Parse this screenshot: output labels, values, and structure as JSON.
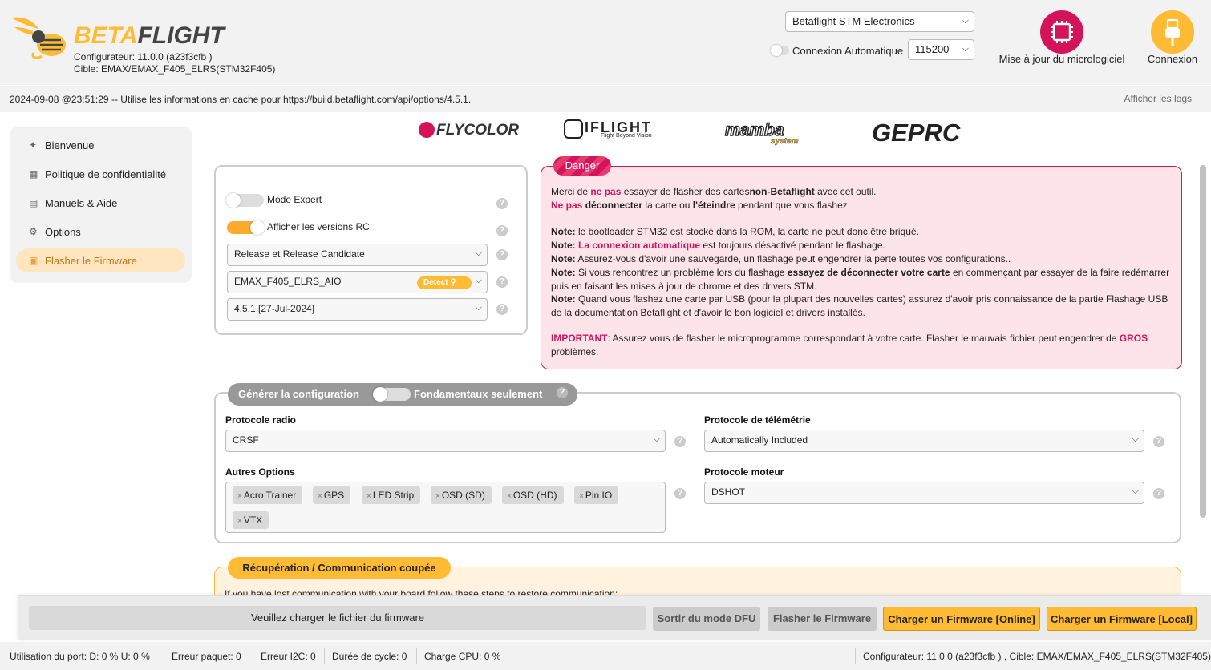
{
  "header": {
    "brand_part1": "BETA",
    "brand_part2": "FLIGHT",
    "configurator_version": "Configurateur: 11.0.0 (a23f3cfb )",
    "target": "Cible: EMAX/EMAX_F405_ELRS(STM32F405)",
    "port_select": "Betaflight STM Electronics",
    "auto_connect_label": "Connexion Automatique",
    "baud_select": "115200",
    "firmware_update_label": "Mise à jour du micrologiciel",
    "connect_label": "Connexion"
  },
  "logbar": {
    "message": "2024-09-08 @23:51:29 -- Utilise les informations en cache pour https://build.betaflight.com/api/options/4.5.1.",
    "show_logs": "Afficher les logs"
  },
  "sidebar": {
    "items": [
      {
        "label": "Bienvenue",
        "icon": "welcome-icon"
      },
      {
        "label": "Politique de confidentialité",
        "icon": "privacy-icon"
      },
      {
        "label": "Manuels & Aide",
        "icon": "book-icon"
      },
      {
        "label": "Options",
        "icon": "gear-icon"
      },
      {
        "label": "Flasher le Firmware",
        "icon": "chip-icon",
        "active": true
      }
    ]
  },
  "sponsors": [
    "FLYCOLOR",
    "IFLIGHT",
    "Flight Beyond Vision",
    "mamba",
    "system",
    "GEPRC"
  ],
  "firmware": {
    "expert_mode": "Mode Expert",
    "show_rc": "Afficher les versions RC",
    "release_select": "Release et Release Candidate",
    "board_select": "EMAX_F405_ELRS_AIO",
    "detect_label": "Detect",
    "version_select": "4.5.1 [27-Jul-2024]",
    "help": "?"
  },
  "danger": {
    "title": "Danger",
    "l1_a": "Merci de ",
    "l1_b": "ne pas",
    "l1_c": " essayer de flasher des cartes",
    "l1_d": "non-Betaflight",
    "l1_e": " avec cet outil.",
    "l2_a": "Ne pas",
    "l2_b": "déconnecter",
    "l2_c": " la carte ou ",
    "l2_d": "l'éteindre",
    "l2_e": " pendant que vous flashez.",
    "note": "Note:",
    "n1": " le bootloader STM32 est stocké dans la ROM, la carte ne peut donc être briqué.",
    "n2_a": "La connexion automatique",
    "n2_b": " est toujours désactivé pendant le flashage.",
    "n3": " Assurez-vous d'avoir une sauvegarde, un flashage peut engendrer la perte toutes vos configurations..",
    "n4_a": " Si vous rencontrez un problème lors du flashage ",
    "n4_b": "essayez de déconnecter votre carte",
    "n4_c": " en commençant par essayer de la faire redémarrer puis en faisant les mises à jour de chrome et des drivers STM.",
    "n5": " Quand vous flashez une carte par USB (pour la plupart des nouvelles cartes) assurez d'avoir pris connaissance de la partie Flashage USB de la documentation Betaflight et d'avoir le bon logiciel et drivers installés.",
    "imp_a": "IMPORTANT",
    "imp_b": ": Assurez vous de flasher le microprogramme correspondant à votre carte. Flasher le mauvais fichier peut engendrer de ",
    "imp_c": "GROS",
    "imp_d": " problèmes."
  },
  "build": {
    "title": "Générer la configuration",
    "core_only": "Fondamentaux seulement",
    "radio_label": "Protocole radio",
    "radio_value": "CRSF",
    "telemetry_label": "Protocole de télémétrie",
    "telemetry_value": "Automatically Included",
    "other_label": "Autres Options",
    "other_tags": [
      "Acro Trainer",
      "GPS",
      "LED Strip",
      "OSD (SD)",
      "OSD (HD)",
      "Pin IO",
      "VTX"
    ],
    "motor_label": "Protocole moteur",
    "motor_value": "DSHOT"
  },
  "recovery": {
    "title": "Récupération / Communication coupée",
    "text": "If you have lost communication with your board follow these steps to restore communication:"
  },
  "actions": {
    "progress": "Veuillez charger le fichier du firmware",
    "exit_dfu": "Sortir du mode DFU",
    "flash": "Flasher le Firmware",
    "load_online": "Charger un Firmware [Online]",
    "load_local": "Charger un Firmware [Local]"
  },
  "status": {
    "port_usage": "Utilisation du port: D: 0 % U: 0 %",
    "packet_error": "Erreur paquet: 0",
    "i2c_error": "Erreur I2C: 0",
    "cycle_time": "Durée de cycle: 0",
    "cpu_load": "Charge CPU: 0 %",
    "right": "Configurateur: 11.0.0 (a23f3cfb ) , Cible: EMAX/EMAX_F405_ELRS(STM32F405)"
  },
  "colors": {
    "accent": "#ffbb33",
    "danger": "#d4145a",
    "danger_bg": "#fce4ea"
  }
}
